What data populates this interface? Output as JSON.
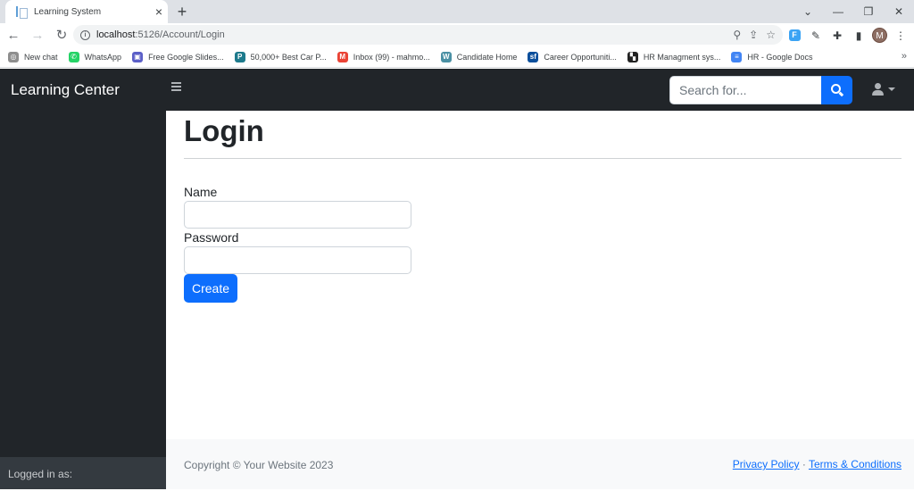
{
  "browser": {
    "tab_title": "Learning System",
    "url_host": "localhost",
    "url_path": ":5126/Account/Login",
    "avatar_letter": "M",
    "bookmarks": [
      {
        "label": "New chat",
        "color": "#8e8e8e",
        "glyph": "◎"
      },
      {
        "label": "WhatsApp",
        "color": "#25d366",
        "glyph": "✆"
      },
      {
        "label": "Free Google Slides...",
        "color": "#5b5fc7",
        "glyph": "▣"
      },
      {
        "label": "50,000+ Best Car P...",
        "color": "#1d7a8c",
        "glyph": "P"
      },
      {
        "label": "Inbox (99) - mahmo...",
        "color": "#ea4335",
        "glyph": "M"
      },
      {
        "label": "Candidate Home",
        "color": "#4a90a4",
        "glyph": "W"
      },
      {
        "label": "Career Opportuniti...",
        "color": "#0b4f9c",
        "glyph": "sf"
      },
      {
        "label": "HR Managment sys...",
        "color": "#222222",
        "glyph": "▚"
      },
      {
        "label": "HR - Google Docs",
        "color": "#4285f4",
        "glyph": "≡"
      }
    ]
  },
  "nav": {
    "brand": "Learning Center",
    "search_placeholder": "Search for..."
  },
  "sidebar": {
    "footer_text": "Logged in as:"
  },
  "main": {
    "title": "Login",
    "name_label": "Name",
    "password_label": "Password",
    "submit_label": "Create"
  },
  "footer": {
    "copyright": "Copyright © Your Website 2023",
    "privacy": "Privacy Policy",
    "separator": "·",
    "terms": "Terms & Conditions"
  },
  "colors": {
    "primary": "#0d6efd",
    "dark": "#212529",
    "sidebar_footer": "#343a40"
  }
}
